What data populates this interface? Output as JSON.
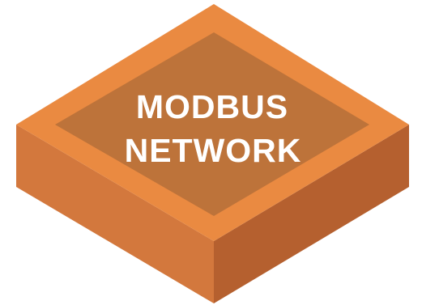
{
  "block": {
    "label_line_1": "MODBUS",
    "label_line_2": "NETWORK"
  },
  "colors": {
    "top_rim": "#EA8A41",
    "top_inner": "#BD733A",
    "side_left": "#D3783D",
    "side_right": "#B5602F",
    "text": "#FFFFFF",
    "background": "#FFFFFF"
  }
}
